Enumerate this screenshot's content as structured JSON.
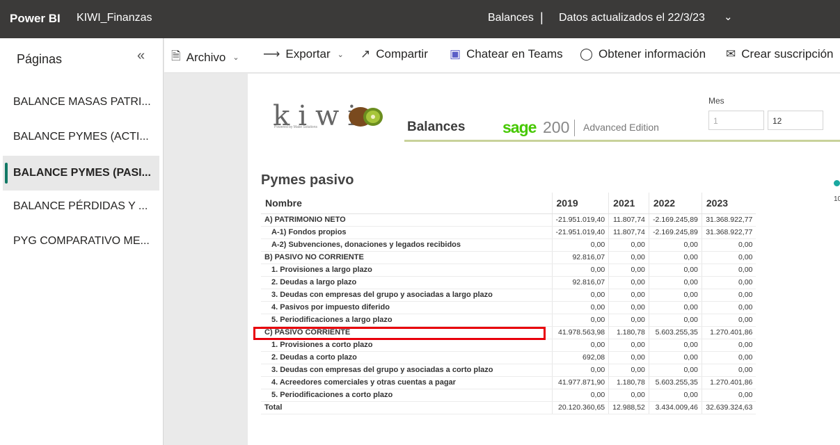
{
  "topbar": {
    "brand": "Power BI",
    "workspace": "KIWI_Finanzas",
    "report": "Balances",
    "separator": "|",
    "updated": "Datos actualizados el 22/3/23"
  },
  "sidebar": {
    "title": "Páginas",
    "items": [
      {
        "label": "BALANCE MASAS PATRI..."
      },
      {
        "label": "BALANCE PYMES (ACTI..."
      },
      {
        "label": "BALANCE PYMES (PASI..."
      },
      {
        "label": "BALANCE PÉRDIDAS Y ..."
      },
      {
        "label": "PYG COMPARATIVO ME..."
      }
    ]
  },
  "toolbar": {
    "archivo": "Archivo",
    "exportar": "Exportar",
    "compartir": "Compartir",
    "teams": "Chatear en Teams",
    "info": "Obtener información",
    "suscripcion": "Crear suscripción"
  },
  "header": {
    "logo_text": "kiwi",
    "logo_sub": "Powered by Make Solutions",
    "title": "Balances",
    "sage": "sage",
    "sage_version": "200",
    "edition": "Advanced Edition",
    "mes_label": "Mes",
    "mes_from": "1",
    "mes_to": "12"
  },
  "side_num": "10",
  "table": {
    "title": "Pymes pasivo",
    "columns": [
      "Nombre",
      "2019",
      "2021",
      "2022",
      "2023"
    ],
    "rows": [
      {
        "name": "A) PATRIMONIO NETO",
        "v": [
          "-21.951.019,40",
          "11.807,74",
          "-2.169.245,89",
          "31.368.922,77"
        ]
      },
      {
        "name": "A-1) Fondos propios",
        "v": [
          "-21.951.019,40",
          "11.807,74",
          "-2.169.245,89",
          "31.368.922,77"
        ]
      },
      {
        "name": "A-2) Subvenciones, donaciones y legados recibidos",
        "v": [
          "0,00",
          "0,00",
          "0,00",
          "0,00"
        ]
      },
      {
        "name": "B) PASIVO NO CORRIENTE",
        "v": [
          "92.816,07",
          "0,00",
          "0,00",
          "0,00"
        ]
      },
      {
        "name": "1. Provisiones a largo plazo",
        "v": [
          "0,00",
          "0,00",
          "0,00",
          "0,00"
        ]
      },
      {
        "name": "2. Deudas a largo plazo",
        "v": [
          "92.816,07",
          "0,00",
          "0,00",
          "0,00"
        ]
      },
      {
        "name": "3. Deudas con empresas del grupo y asociadas a largo plazo",
        "v": [
          "0,00",
          "0,00",
          "0,00",
          "0,00"
        ]
      },
      {
        "name": "4. Pasivos por impuesto diferido",
        "v": [
          "0,00",
          "0,00",
          "0,00",
          "0,00"
        ]
      },
      {
        "name": "5. Periodificaciones a largo plazo",
        "v": [
          "0,00",
          "0,00",
          "0,00",
          "0,00"
        ]
      },
      {
        "name": "C) PASIVO CORRIENTE",
        "v": [
          "41.978.563,98",
          "1.180,78",
          "5.603.255,35",
          "1.270.401,86"
        ]
      },
      {
        "name": "1. Provisiones a corto plazo",
        "v": [
          "0,00",
          "0,00",
          "0,00",
          "0,00"
        ]
      },
      {
        "name": "2. Deudas a corto plazo",
        "v": [
          "692,08",
          "0,00",
          "0,00",
          "0,00"
        ]
      },
      {
        "name": "3. Deudas con empresas del grupo y asociadas a corto plazo",
        "v": [
          "0,00",
          "0,00",
          "0,00",
          "0,00"
        ]
      },
      {
        "name": "4. Acreedores comerciales y otras cuentas a pagar",
        "v": [
          "41.977.871,90",
          "1.180,78",
          "5.603.255,35",
          "1.270.401,86"
        ]
      },
      {
        "name": "5. Periodificaciones a corto plazo",
        "v": [
          "0,00",
          "0,00",
          "0,00",
          "0,00"
        ]
      },
      {
        "name": "Total",
        "v": [
          "20.120.360,65",
          "12.988,52",
          "3.434.009,46",
          "32.639.324,63"
        ]
      }
    ]
  },
  "colors": {
    "accent": "#117865",
    "highlight": "#e8000b",
    "sage": "#46c800"
  }
}
